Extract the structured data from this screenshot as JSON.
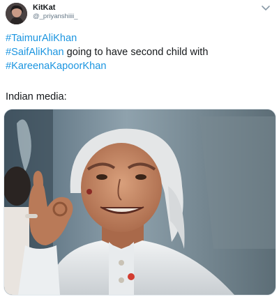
{
  "author": {
    "display_name": "KitKat",
    "handle": "@_priyanshiiii_"
  },
  "tweet": {
    "line1": {
      "hashtag": "#TaimurAliKhan"
    },
    "line2": {
      "hashtag": "#SaifAliKhan",
      "text": " going to have second child with"
    },
    "line3": {
      "hashtag": "#KareenaKapoorKhan"
    },
    "caption": "Indian media:"
  },
  "colors": {
    "hashtag": "#1b95e0",
    "text": "#14171a",
    "handle": "#657786"
  },
  "icons": {
    "menu": "chevron-down-icon"
  }
}
